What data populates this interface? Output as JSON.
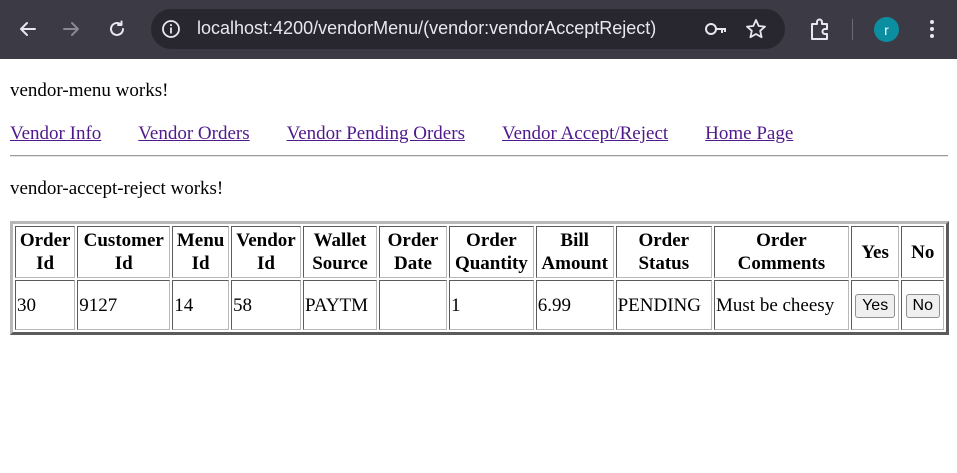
{
  "browser": {
    "url": "localhost:4200/vendorMenu/(vendor:vendorAcceptReject)",
    "profile_initial": "r",
    "icons": {
      "back": "back-arrow-icon",
      "forward": "forward-arrow-icon",
      "reload": "reload-icon",
      "site_info": "info-icon",
      "password": "key-icon",
      "bookmark": "star-icon",
      "extensions": "puzzle-icon",
      "menu": "kebab-menu-icon"
    },
    "colors": {
      "chrome": "#3c3b45",
      "omnibox": "#28272f",
      "avatar": "#0b8ea0"
    }
  },
  "page": {
    "menu_works": "vendor-menu works!",
    "nav": [
      {
        "label": "Vendor Info"
      },
      {
        "label": "Vendor Orders"
      },
      {
        "label": "Vendor Pending Orders"
      },
      {
        "label": "Vendor Accept/Reject"
      },
      {
        "label": "Home Page"
      }
    ],
    "accept_reject_works": "vendor-accept-reject works!",
    "link_color": "#4f1a8c"
  },
  "table": {
    "headers": [
      [
        "Order",
        "Id"
      ],
      [
        "Customer",
        "Id"
      ],
      [
        "Menu",
        "Id"
      ],
      [
        "Vendor",
        "Id"
      ],
      [
        "Wallet",
        "Source"
      ],
      [
        "Order",
        "Date"
      ],
      [
        "Order",
        "Quantity"
      ],
      [
        "Bill",
        "Amount"
      ],
      [
        "Order",
        "Status"
      ],
      [
        "Order",
        "Comments"
      ],
      [
        "Yes"
      ],
      [
        "No"
      ]
    ],
    "rows": [
      {
        "order_id": "30",
        "customer_id": "9127",
        "menu_id": "14",
        "vendor_id": "58",
        "wallet_source": "PAYTM",
        "order_date": "",
        "order_quantity": "1",
        "bill_amount": "6.99",
        "order_status": "PENDING",
        "order_comments": "Must be cheesy",
        "yes_label": "Yes",
        "no_label": "No"
      }
    ]
  }
}
